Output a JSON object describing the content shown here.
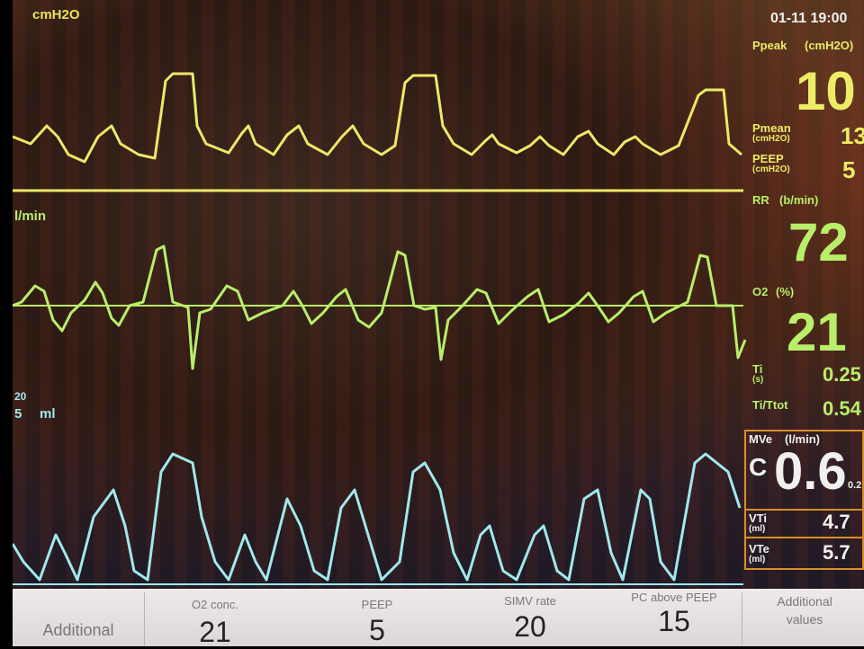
{
  "header": {
    "datetime": "01-11 19:00",
    "pressure_unit": "cmH2O",
    "flow_unit": "l/min",
    "volume_unit": "ml",
    "volume_scale_top": "20",
    "volume_scale_sub": "5"
  },
  "monitor": {
    "ppeak": {
      "label": "Ppeak",
      "unit": "(cmH2O)",
      "value": "10"
    },
    "pmean": {
      "label": "Pmean",
      "unit": "(cmH2O)",
      "value": "13"
    },
    "peep": {
      "label": "PEEP",
      "unit": "(cmH2O)",
      "value": "5"
    },
    "rr": {
      "label": "RR",
      "unit": "(b/min)",
      "value": "72"
    },
    "o2": {
      "label": "O2",
      "unit": "(%)",
      "value": "21"
    },
    "ti": {
      "label": "Ti",
      "unit": "(s)",
      "value": "0.25"
    },
    "ti_ttot": {
      "label": "Ti/Ttot",
      "value": "0.54"
    },
    "mve": {
      "label": "MVe",
      "unit": "(l/min)",
      "mode": "C",
      "value": "0.6",
      "sub": "0.2"
    },
    "vti": {
      "label": "VTi",
      "unit": "(ml)",
      "value": "4.7"
    },
    "vte": {
      "label": "VTe",
      "unit": "(ml)",
      "value": "5.7"
    }
  },
  "controls": {
    "additional": "Additional",
    "o2_conc": {
      "label": "O2 conc.",
      "value": "21"
    },
    "peep": {
      "label": "PEEP",
      "value": "5"
    },
    "simv_rate": {
      "label": "SIMV rate",
      "value": "20"
    },
    "pc_above_peep": {
      "label": "PC above PEEP",
      "value": "15"
    },
    "additional_values": {
      "line1": "Additional",
      "line2": "values"
    }
  },
  "colors": {
    "pressure": "#ece86a",
    "flow": "#b8ee6a",
    "flow_insp": "#ee7ad2",
    "volume": "#9fe8ee",
    "alarm_box": "#d88f2a"
  }
}
